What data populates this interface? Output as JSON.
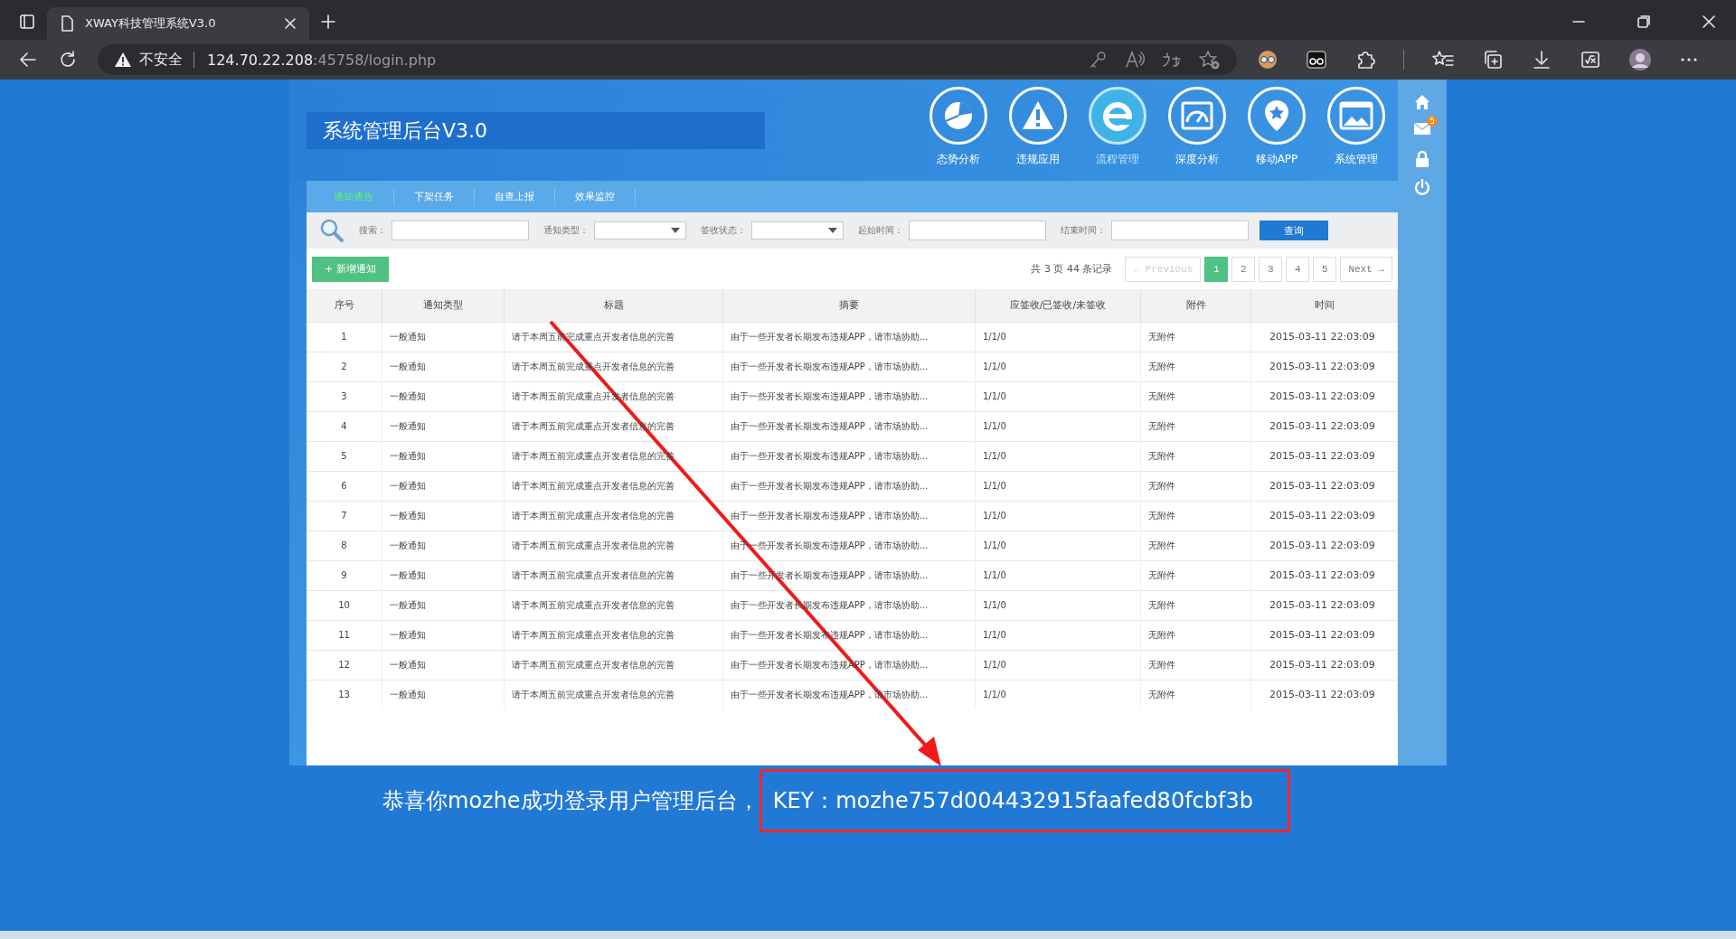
{
  "browser": {
    "tab_title": "XWAY科技管理系统V3.0",
    "security_label": "不安全",
    "url_host": "124.70.22.208",
    "url_rest": ":45758/login.php"
  },
  "admin": {
    "title": "系统管理后台V3.0",
    "modules": [
      {
        "label": "态势分析",
        "kind": "pie",
        "selected": false
      },
      {
        "label": "违规应用",
        "kind": "warning",
        "selected": false
      },
      {
        "label": "流程管理",
        "kind": "browser",
        "selected": true
      },
      {
        "label": "深度分析",
        "kind": "gauge",
        "selected": false
      },
      {
        "label": "移动APP",
        "kind": "star",
        "selected": false
      },
      {
        "label": "系统管理",
        "kind": "window",
        "selected": false
      }
    ],
    "mail_badge": "5",
    "subtabs": [
      {
        "label": "通知通告",
        "selected": true
      },
      {
        "label": "下架任务",
        "selected": false
      },
      {
        "label": "自查上报",
        "selected": false
      },
      {
        "label": "效果监控",
        "selected": false
      }
    ],
    "filters": [
      {
        "kind": "text",
        "label": "搜索："
      },
      {
        "kind": "select",
        "label": "通知类型："
      },
      {
        "kind": "select",
        "label": "签收状态："
      },
      {
        "kind": "text",
        "label": "起始时间："
      },
      {
        "kind": "text",
        "label": "结束时间："
      }
    ],
    "query_button": "查询",
    "add_button": "+ 新增通知",
    "summary": "共 3 页 44 条记录",
    "pages": [
      {
        "label": "← Previous",
        "kind": "prev",
        "selected": false,
        "disabled": true
      },
      {
        "label": "1",
        "kind": "page",
        "selected": true,
        "disabled": false
      },
      {
        "label": "2",
        "kind": "page",
        "selected": false,
        "disabled": false
      },
      {
        "label": "3",
        "kind": "page",
        "selected": false,
        "disabled": false
      },
      {
        "label": "4",
        "kind": "page",
        "selected": false,
        "disabled": false
      },
      {
        "label": "5",
        "kind": "page",
        "selected": false,
        "disabled": false
      },
      {
        "label": "Next →",
        "kind": "next",
        "selected": false,
        "disabled": false
      }
    ],
    "table": {
      "columns": [
        "序号",
        "通知类型",
        "标题",
        "摘要",
        "应签收/已签收/未签收",
        "附件",
        "时间"
      ],
      "rows": [
        [
          "1",
          "一般通知",
          "请于本周五前完成重点开发者信息的完善",
          "由于一些开发者长期发布违规APP，请市场协助...",
          "1/1/0",
          "无附件",
          "2015-03-11 22:03:09"
        ],
        [
          "2",
          "一般通知",
          "请于本周五前完成重点开发者信息的完善",
          "由于一些开发者长期发布违规APP，请市场协助...",
          "1/1/0",
          "无附件",
          "2015-03-11 22:03:09"
        ],
        [
          "3",
          "一般通知",
          "请于本周五前完成重点开发者信息的完善",
          "由于一些开发者长期发布违规APP，请市场协助...",
          "1/1/0",
          "无附件",
          "2015-03-11 22:03:09"
        ],
        [
          "4",
          "一般通知",
          "请于本周五前完成重点开发者信息的完善",
          "由于一些开发者长期发布违规APP，请市场协助...",
          "1/1/0",
          "无附件",
          "2015-03-11 22:03:09"
        ],
        [
          "5",
          "一般通知",
          "请于本周五前完成重点开发者信息的完善",
          "由于一些开发者长期发布违规APP，请市场协助...",
          "1/1/0",
          "无附件",
          "2015-03-11 22:03:09"
        ],
        [
          "6",
          "一般通知",
          "请于本周五前完成重点开发者信息的完善",
          "由于一些开发者长期发布违规APP，请市场协助...",
          "1/1/0",
          "无附件",
          "2015-03-11 22:03:09"
        ],
        [
          "7",
          "一般通知",
          "请于本周五前完成重点开发者信息的完善",
          "由于一些开发者长期发布违规APP，请市场协助...",
          "1/1/0",
          "无附件",
          "2015-03-11 22:03:09"
        ],
        [
          "8",
          "一般通知",
          "请于本周五前完成重点开发者信息的完善",
          "由于一些开发者长期发布违规APP，请市场协助...",
          "1/1/0",
          "无附件",
          "2015-03-11 22:03:09"
        ],
        [
          "9",
          "一般通知",
          "请于本周五前完成重点开发者信息的完善",
          "由于一些开发者长期发布违规APP，请市场协助...",
          "1/1/0",
          "无附件",
          "2015-03-11 22:03:09"
        ],
        [
          "10",
          "一般通知",
          "请于本周五前完成重点开发者信息的完善",
          "由于一些开发者长期发布违规APP，请市场协助...",
          "1/1/0",
          "无附件",
          "2015-03-11 22:03:09"
        ],
        [
          "11",
          "一般通知",
          "请于本周五前完成重点开发者信息的完善",
          "由于一些开发者长期发布违规APP，请市场协助...",
          "1/1/0",
          "无附件",
          "2015-03-11 22:03:09"
        ],
        [
          "12",
          "一般通知",
          "请于本周五前完成重点开发者信息的完善",
          "由于一些开发者长期发布违规APP，请市场协助...",
          "1/1/0",
          "无附件",
          "2015-03-11 22:03:09"
        ],
        [
          "13",
          "一般通知",
          "请于本周五前完成重点开发者信息的完善",
          "由于一些开发者长期发布违规APP，请市场协助...",
          "1/1/0",
          "无附件",
          "2015-03-11 22:03:09"
        ]
      ]
    }
  },
  "message": {
    "text": "恭喜你mozhe成功登录用户管理后台，",
    "key": "KEY：mozhe757d004432915faafed80fcbf3b"
  }
}
